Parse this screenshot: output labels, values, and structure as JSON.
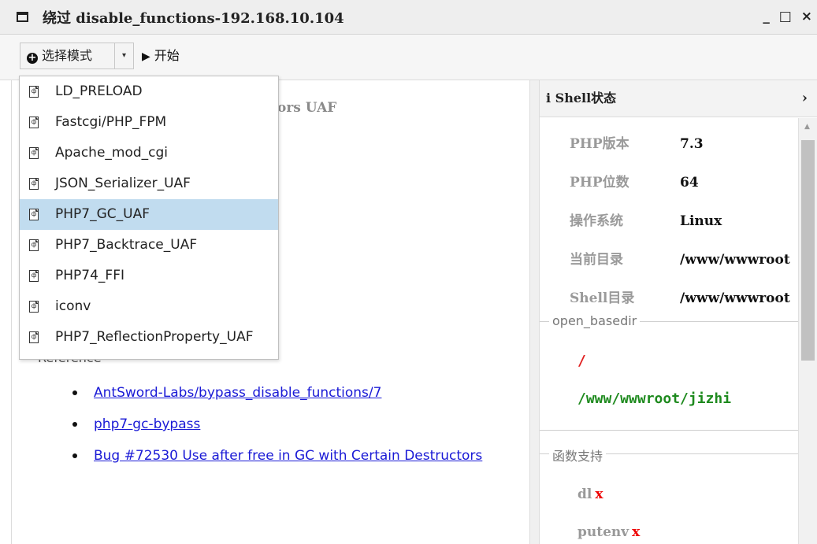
{
  "window": {
    "title": "绕过 disable_functions-192.168.10.104",
    "controls": {
      "minimize": "_",
      "maximize": "□",
      "close": "×"
    }
  },
  "toolbar": {
    "mode_label": "选择模式",
    "mode_icon": "plus-circle-icon",
    "dropdown_arrow": "▾",
    "start_label": "开始",
    "start_icon": "▶"
  },
  "dropdown": {
    "items": [
      {
        "label": "LD_PRELOAD",
        "selected": false
      },
      {
        "label": "Fastcgi/PHP_FPM",
        "selected": false
      },
      {
        "label": "Apache_mod_cgi",
        "selected": false
      },
      {
        "label": "JSON_Serializer_UAF",
        "selected": false
      },
      {
        "label": "PHP7_GC_UAF",
        "selected": true
      },
      {
        "label": "PHP7_Backtrace_UAF",
        "selected": false
      },
      {
        "label": "PHP74_FFI",
        "selected": false
      },
      {
        "label": "iconv",
        "selected": false
      },
      {
        "label": "PHP7_ReflectionProperty_UAF",
        "selected": false
      }
    ],
    "item_icon": "php-file-icon"
  },
  "main": {
    "description_tail": "ors UAF",
    "reference_label": "Reference",
    "references": [
      "AntSword-Labs/bypass_disable_functions/7",
      "php7-gc-bypass",
      "Bug #72530 Use after free in GC with Certain Destructors"
    ]
  },
  "shell_status": {
    "header": "Shell状态",
    "header_icon": "i",
    "collapse_icon": "›",
    "rows": [
      {
        "key": "PHP版本",
        "value": "7.3"
      },
      {
        "key": "PHP位数",
        "value": "64"
      },
      {
        "key": "操作系统",
        "value": "Linux"
      },
      {
        "key": "当前目录",
        "value": "/www/wwwroot"
      },
      {
        "key": "Shell目录",
        "value": "/www/wwwroot"
      }
    ],
    "open_basedir": {
      "legend": "open_basedir",
      "paths": [
        "/",
        "/www/wwwroot/jizhi"
      ],
      "path_colors": [
        "#e02020",
        "#1e8a1e"
      ]
    },
    "functions": {
      "legend": "函数支持",
      "items": [
        {
          "name": "dl",
          "mark": "x"
        },
        {
          "name": "putenv",
          "mark": "x"
        }
      ]
    }
  }
}
